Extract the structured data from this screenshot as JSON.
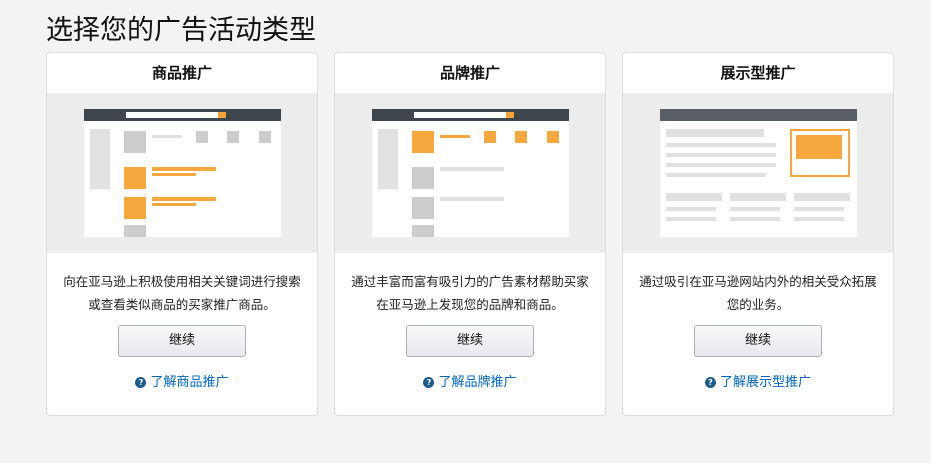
{
  "page_title": "选择您的广告活动类型",
  "cards": [
    {
      "title": "商品推广",
      "description": "向在亚马逊上积极使用相关关键词进行搜索或查看类似商品的买家推广商品。",
      "button": "继续",
      "link": "了解商品推广"
    },
    {
      "title": "品牌推广",
      "description": "通过丰富而富有吸引力的广告素材帮助买家在亚马逊上发现您的品牌和商品。",
      "button": "继续",
      "link": "了解品牌推广"
    },
    {
      "title": "展示型推广",
      "description": "通过吸引在亚马逊网站内外的相关受众拓展您的业务。",
      "button": "继续",
      "link": "了解展示型推广"
    }
  ],
  "colors": {
    "accent": "#f6a83e",
    "link": "#0066c0"
  }
}
